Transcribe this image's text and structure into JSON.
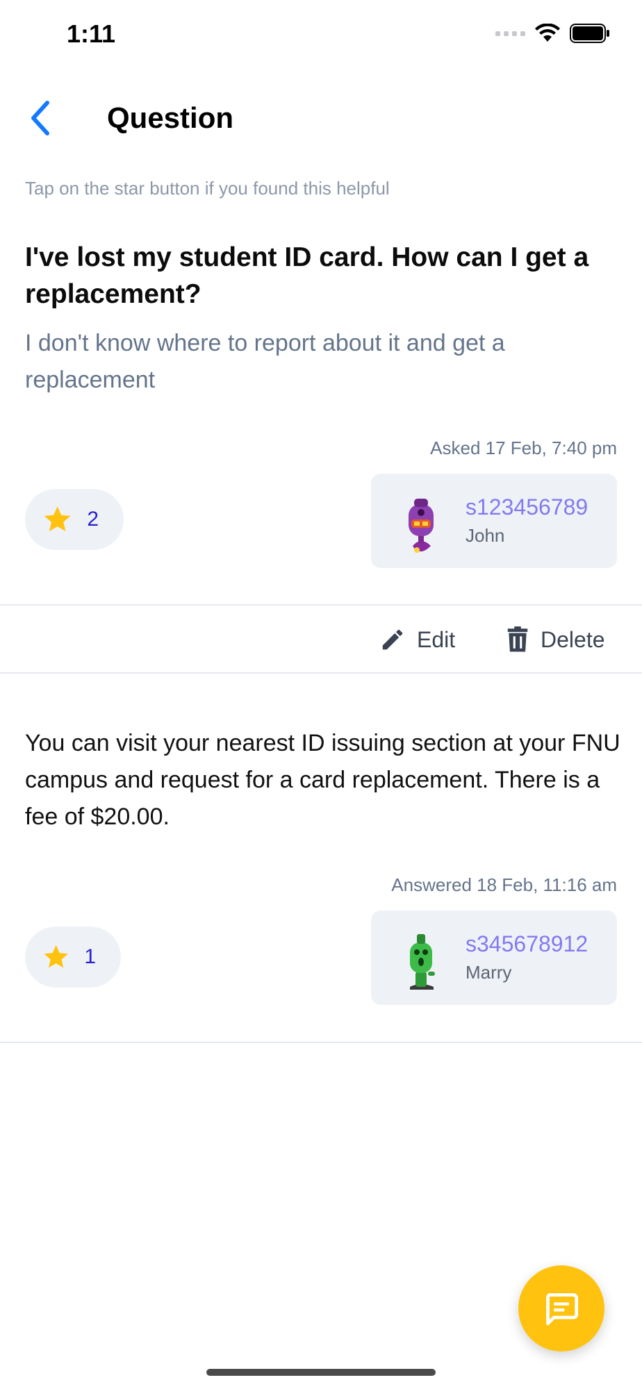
{
  "status_bar": {
    "time": "1:11"
  },
  "header": {
    "title": "Question",
    "back_icon": "chevron-left-icon"
  },
  "hint": "Tap on the star button if you found this helpful",
  "question": {
    "title": "I've lost my student ID card. How can I get a replacement?",
    "body": "I don't know where to report about it and get a replacement",
    "meta": "Asked 17 Feb, 7:40 pm",
    "stars": "2",
    "author": {
      "id": "s123456789",
      "name": "John"
    }
  },
  "actions": {
    "edit_label": "Edit",
    "delete_label": "Delete"
  },
  "answer": {
    "text": "You can visit your nearest ID issuing section at your FNU campus and request for a card replacement. There is a fee of $20.00.",
    "meta": "Answered 18 Feb, 11:16 am",
    "stars": "1",
    "author": {
      "id": "s345678912",
      "name": "Marry"
    }
  },
  "colors": {
    "accent": "#ffc20f",
    "link": "#1479ff",
    "star": "#ffc20f",
    "user_id": "#8479ee"
  }
}
